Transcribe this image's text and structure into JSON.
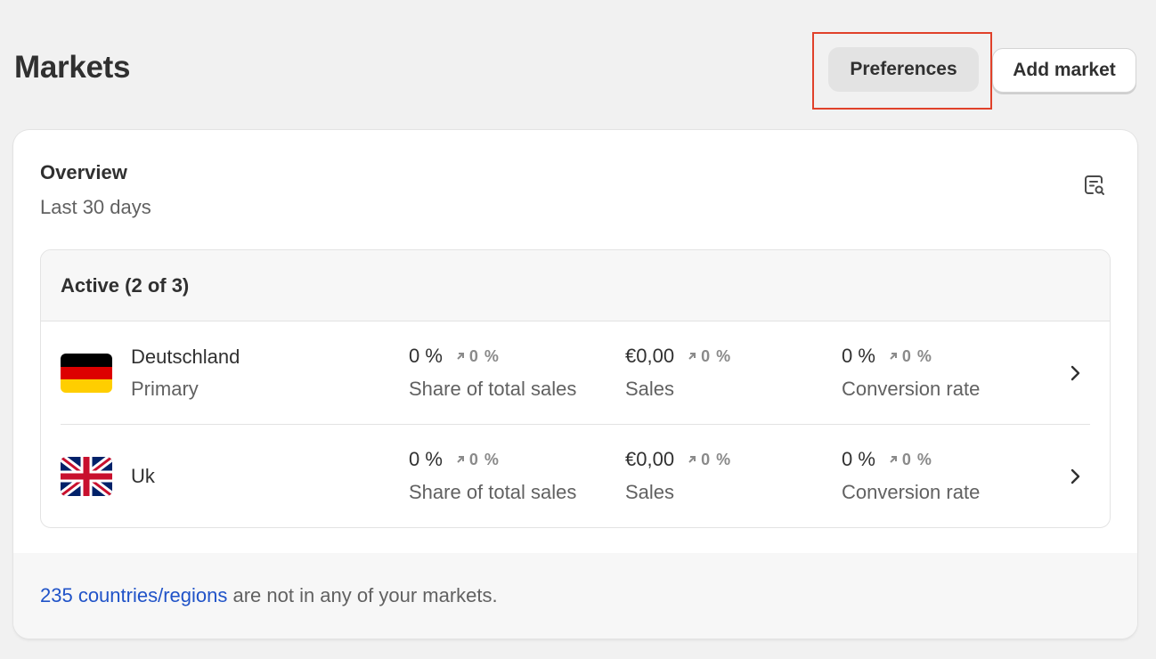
{
  "header": {
    "title": "Markets",
    "preferences_label": "Preferences",
    "add_market_label": "Add market"
  },
  "overview": {
    "title": "Overview",
    "subtitle": "Last 30 days",
    "icon": "report-search-icon"
  },
  "active": {
    "heading": "Active (2 of 3)",
    "markets": [
      {
        "name": "Deutschland",
        "subtitle": "Primary",
        "flag": "germany-flag",
        "share": {
          "value": "0 %",
          "delta": "0 %",
          "label": "Share of total sales"
        },
        "sales": {
          "value": "€0,00",
          "delta": "0 %",
          "label": "Sales"
        },
        "conversion": {
          "value": "0 %",
          "delta": "0 %",
          "label": "Conversion rate"
        }
      },
      {
        "name": "Uk",
        "subtitle": "",
        "flag": "uk-flag",
        "share": {
          "value": "0 %",
          "delta": "0 %",
          "label": "Share of total sales"
        },
        "sales": {
          "value": "€0,00",
          "delta": "0 %",
          "label": "Sales"
        },
        "conversion": {
          "value": "0 %",
          "delta": "0 %",
          "label": "Conversion rate"
        }
      }
    ]
  },
  "footer": {
    "link_text": "235 countries/regions",
    "rest_text": " are not in any of your markets."
  },
  "colors": {
    "background": "#f1f1f1",
    "highlight": "#e0412a",
    "link": "#2053c8"
  }
}
